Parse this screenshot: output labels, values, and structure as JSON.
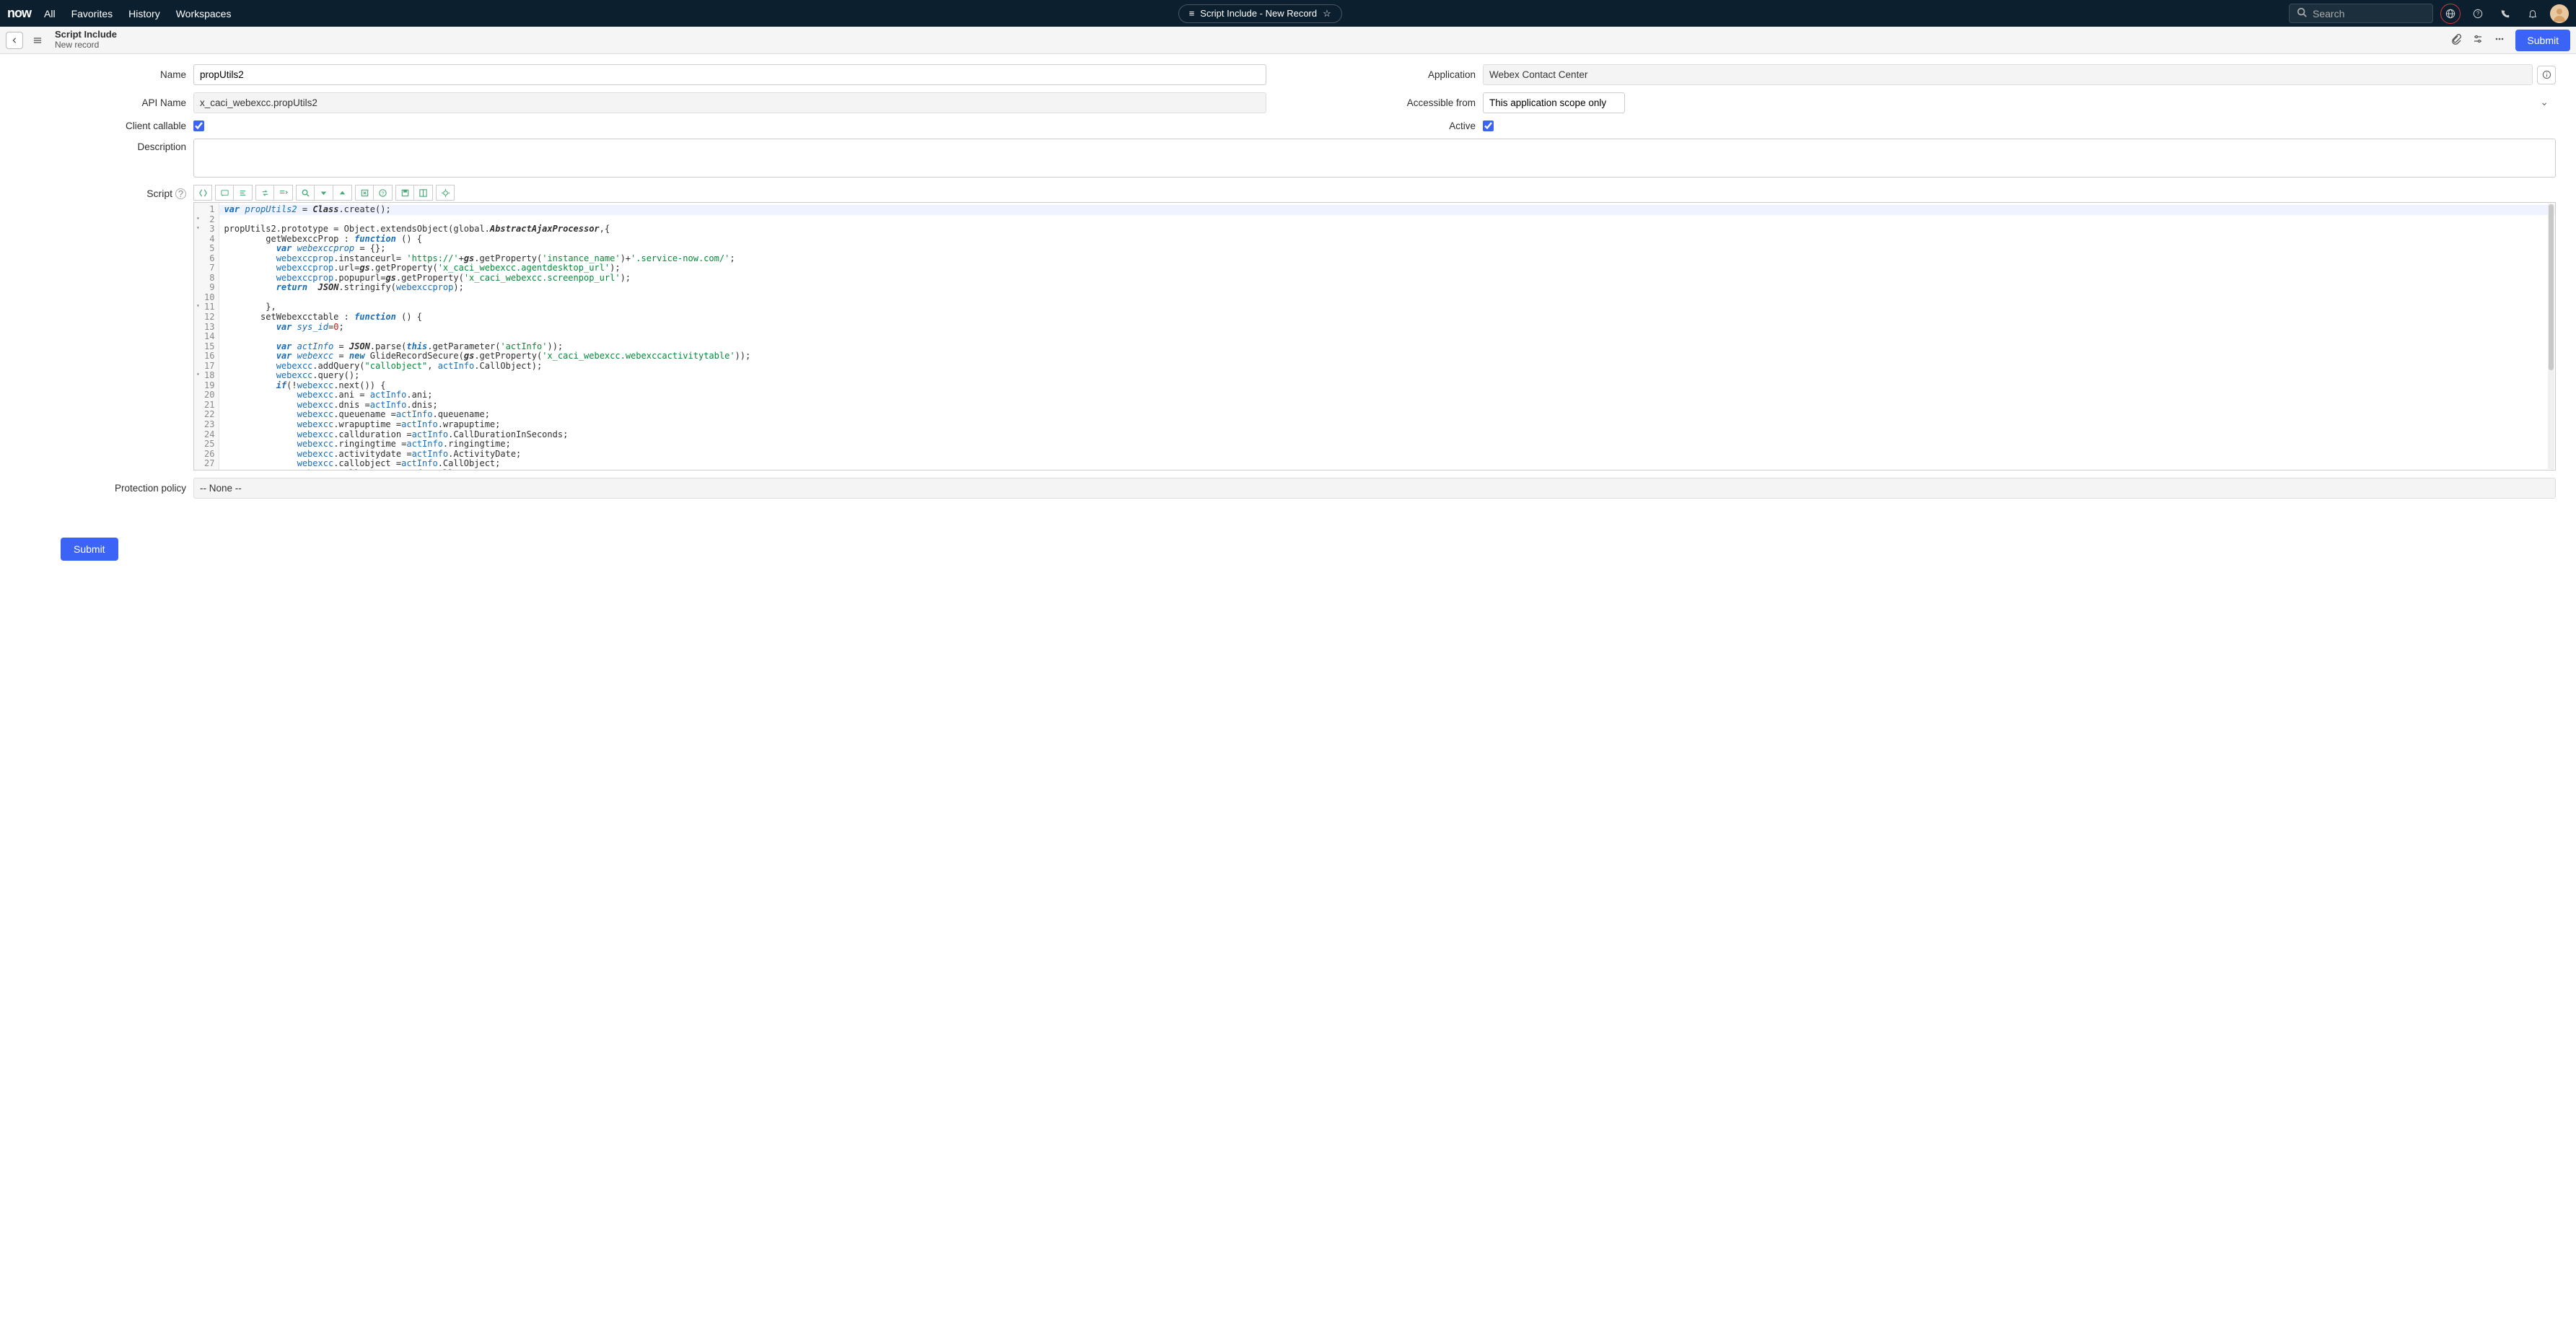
{
  "topbar": {
    "logo": "now",
    "nav": [
      "All",
      "Favorites",
      "History",
      "Workspaces"
    ],
    "title": "Script Include - New Record",
    "search_placeholder": "Search"
  },
  "subheader": {
    "title": "Script Include",
    "subtitle": "New record",
    "submit_label": "Submit"
  },
  "form": {
    "name_label": "Name",
    "name_value": "propUtils2",
    "api_name_label": "API Name",
    "api_name_value": "x_caci_webexcc.propUtils2",
    "client_callable_label": "Client callable",
    "client_callable_checked": true,
    "application_label": "Application",
    "application_value": "Webex Contact Center",
    "accessible_from_label": "Accessible from",
    "accessible_from_value": "This application scope only",
    "active_label": "Active",
    "active_checked": true,
    "description_label": "Description",
    "description_value": "",
    "script_label": "Script",
    "protection_label": "Protection policy",
    "protection_value": "-- None --"
  },
  "script_lines": {
    "total": 27
  },
  "submit_bottom_label": "Submit"
}
